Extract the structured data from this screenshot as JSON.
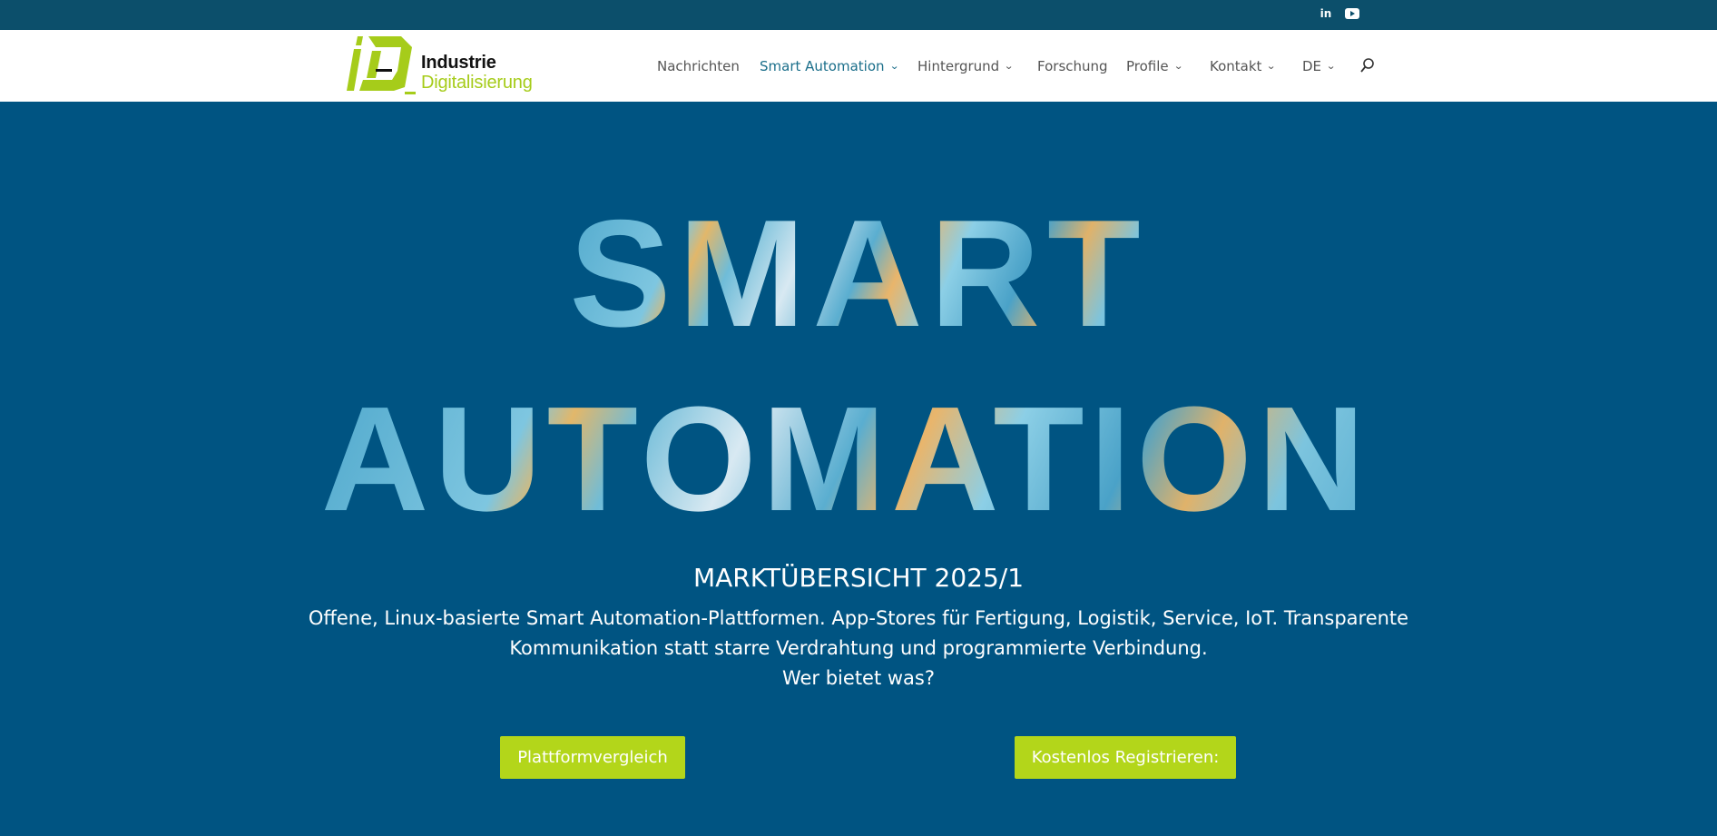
{
  "topbar": {
    "linkedin_label": "in"
  },
  "logo": {
    "line1": "Industrie",
    "line2": "Digitalisierung"
  },
  "nav": [
    {
      "label": "Nachrichten",
      "has_dropdown": false
    },
    {
      "label": "Smart Automation",
      "has_dropdown": true,
      "active": true
    },
    {
      "label": "Hintergrund",
      "has_dropdown": true
    },
    {
      "label": "Forschung",
      "has_dropdown": false
    },
    {
      "label": "Profile",
      "has_dropdown": true
    },
    {
      "label": "Kontakt",
      "has_dropdown": true
    },
    {
      "label": "DE",
      "has_dropdown": true
    }
  ],
  "hero": {
    "title_line1": "SMART",
    "title_line2": "AUTOMATION",
    "subtitle": "MARKTÜBERSICHT 2025/1",
    "description_lines": [
      "Offene, Linux-basierte Smart Automation-Plattformen. App-Stores für Fertigung, Logistik, Service, IoT.  Transparente",
      "Kommunikation statt starre Verdrahtung und programmierte Verbindung.",
      "Wer bietet was?"
    ]
  },
  "buttons": {
    "compare": "Plattformvergleich",
    "register": "Kostenlos Registrieren:"
  },
  "colors": {
    "topbar": "#0c4f6b",
    "hero_bg": "#005482",
    "accent_green": "#b3d61a",
    "nav_active": "#1a6e8a"
  },
  "icons": {
    "social": [
      "linkedin-icon",
      "youtube-icon"
    ],
    "search": "search-icon",
    "dropdown": "chevron-down-icon"
  }
}
